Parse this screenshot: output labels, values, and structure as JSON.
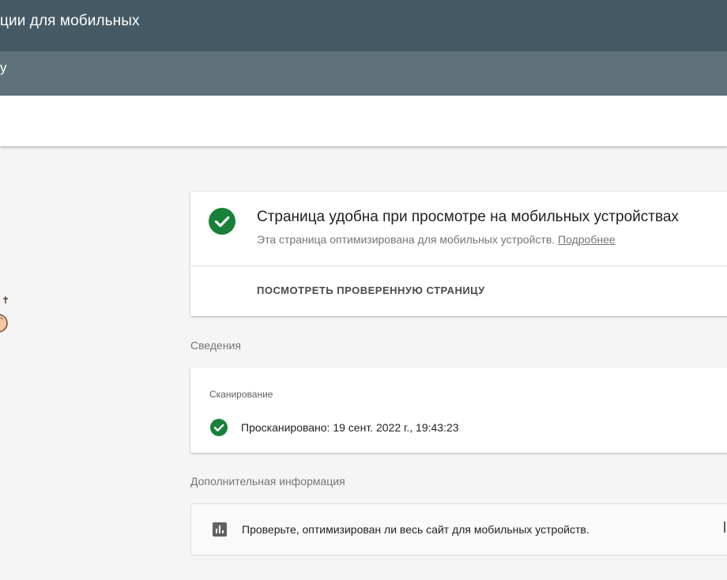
{
  "header": {
    "title": "ции для мобильных",
    "subtitle": "y"
  },
  "result": {
    "title": "Страница удобна при просмотре на мобильных устройствах",
    "description": "Эта страница оптимизирована для мобильных устройств.",
    "more_link": "Подробнее",
    "view_button": "ПОСМОТРЕТЬ ПРОВЕРЕННУЮ СТРАНИЦУ"
  },
  "details": {
    "section_label": "Сведения",
    "crawl_heading": "Сканирование",
    "crawl_status": "Просканировано: 19 сент. 2022 г., 19:43:23"
  },
  "more_info": {
    "section_label": "Дополнительная информация",
    "site_check_text": "Проверьте, оптимизирован ли весь сайт для мобильных устройств."
  },
  "colors": {
    "topbar": "#455a64",
    "subbar": "#5f7179",
    "success": "#188038",
    "background": "#f5f5f5"
  },
  "icons": {
    "status": "check-circle-icon",
    "site_check": "bar-chart-icon"
  }
}
